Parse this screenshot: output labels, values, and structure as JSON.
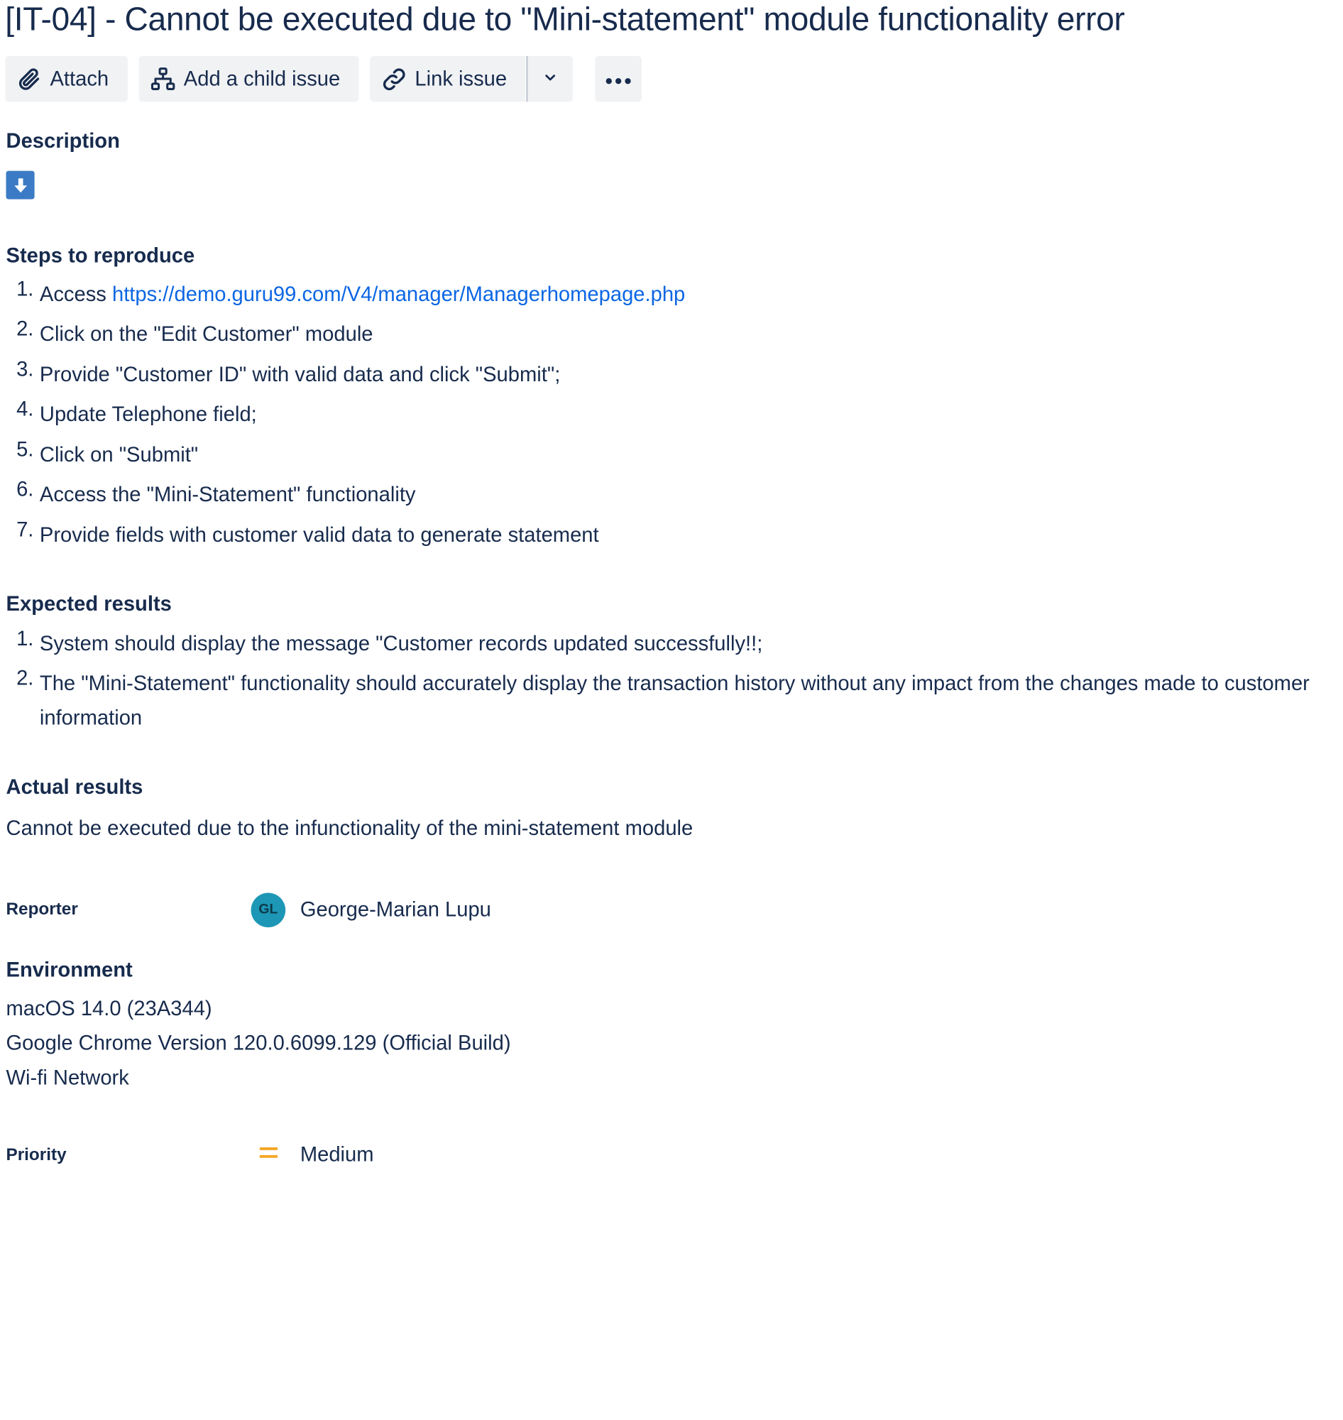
{
  "issue": {
    "title": "[IT-04] - Cannot be executed due to \"Mini-statement\" module functionality error"
  },
  "toolbar": {
    "attach_label": "Attach",
    "attach_icon": "paperclip-icon",
    "child_label": "Add a child issue",
    "child_icon": "hierarchy-icon",
    "link_label": "Link issue",
    "link_icon": "link-icon",
    "dropdown_icon": "chevron-down-icon",
    "more_icon": "more-horizontal-icon"
  },
  "description": {
    "heading": "Description",
    "icon": "download-arrow-icon",
    "steps_heading": "Steps to reproduce",
    "steps": [
      {
        "num": "1.",
        "text": "Access ",
        "link": "https://demo.guru99.com/V4/manager/Managerhomepage.php"
      },
      {
        "num": "2.",
        "text": "Click on the \"Edit Customer\" module"
      },
      {
        "num": "3.",
        "text": "Provide \"Customer ID\" with valid data and click \"Submit\";"
      },
      {
        "num": "4.",
        "text": "Update Telephone field;"
      },
      {
        "num": "5.",
        "text": "Click on \"Submit\""
      },
      {
        "num": "6.",
        "text": "Access the \"Mini-Statement\" functionality"
      },
      {
        "num": "7.",
        "text": "Provide fields with customer valid data to generate statement"
      }
    ],
    "expected_heading": "Expected results",
    "expected": [
      {
        "num": "1.",
        "text": "System should display the message \"Customer records updated successfully!!;"
      },
      {
        "num": "2.",
        "text": "The \"Mini-Statement\" functionality should accurately display the transaction history without any impact from the changes made to customer information"
      }
    ],
    "actual_heading": "Actual results",
    "actual_text": "Cannot be executed due to the infunctionality of the mini-statement module"
  },
  "reporter": {
    "label": "Reporter",
    "initials": "GL",
    "name": "George-Marian Lupu",
    "avatar_color": "#1d97b5"
  },
  "environment": {
    "heading": "Environment",
    "lines": [
      "macOS 14.0 (23A344)",
      "Google Chrome Version 120.0.6099.129 (Official Build)",
      "Wi-fi Network"
    ]
  },
  "priority": {
    "label": "Priority",
    "value": "Medium",
    "icon": "priority-medium-icon",
    "icon_color": "#f5a524"
  }
}
